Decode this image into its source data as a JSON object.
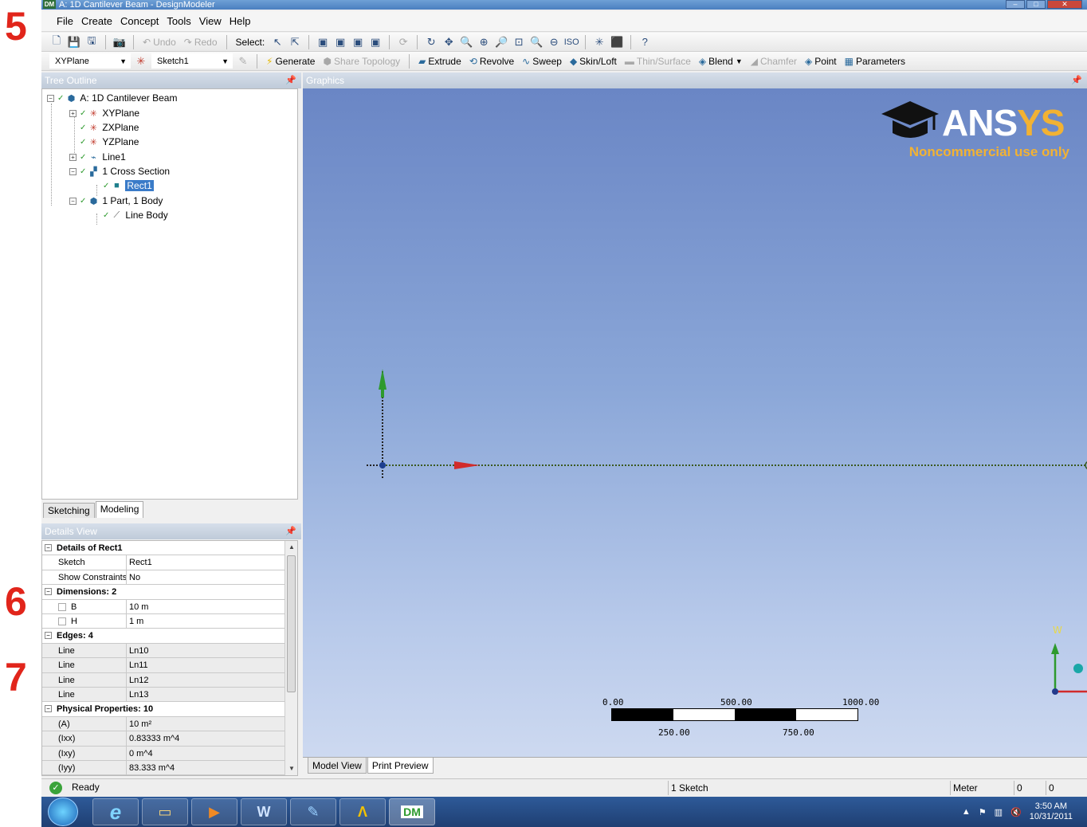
{
  "annotations": [
    "5",
    "6",
    "7"
  ],
  "window": {
    "title": "A: 1D Cantilever Beam - DesignModeler",
    "app_icon": "DM"
  },
  "menu": [
    "File",
    "Create",
    "Concept",
    "Tools",
    "View",
    "Help"
  ],
  "toolbar1": {
    "undo_label": "Undo",
    "redo_label": "Redo",
    "select_label": "Select:"
  },
  "toolbar2": {
    "plane_select": "XYPlane",
    "sketch_select": "Sketch1",
    "generate": "Generate",
    "share_topology": "Share Topology",
    "extrude": "Extrude",
    "revolve": "Revolve",
    "sweep": "Sweep",
    "skin_loft": "Skin/Loft",
    "thin_surface": "Thin/Surface",
    "blend": "Blend",
    "chamfer": "Chamfer",
    "point": "Point",
    "parameters": "Parameters"
  },
  "tree": {
    "header": "Tree Outline",
    "root": "A: 1D Cantilever Beam",
    "items": [
      "XYPlane",
      "ZXPlane",
      "YZPlane",
      "Line1",
      "1 Cross Section",
      "Rect1",
      "1 Part, 1 Body",
      "Line Body"
    ]
  },
  "mode_tabs": [
    "Sketching",
    "Modeling"
  ],
  "details": {
    "header": "Details View",
    "title_group": "Details of Rect1",
    "rows_main": [
      {
        "label": "Sketch",
        "value": "Rect1"
      },
      {
        "label": "Show Constraints?",
        "value": "No"
      }
    ],
    "dimensions_group": "Dimensions: 2",
    "dimensions": [
      {
        "label": "B",
        "value": "10 m"
      },
      {
        "label": "H",
        "value": "1 m"
      }
    ],
    "edges_group": "Edges: 4",
    "edges": [
      {
        "label": "Line",
        "value": "Ln10"
      },
      {
        "label": "Line",
        "value": "Ln11"
      },
      {
        "label": "Line",
        "value": "Ln12"
      },
      {
        "label": "Line",
        "value": "Ln13"
      }
    ],
    "physical_group": "Physical Properties: 10",
    "physical": [
      {
        "label": "(A)",
        "value": "10 m²"
      },
      {
        "label": "(Ixx)",
        "value": "0.83333 m^4"
      },
      {
        "label": "(Ixy)",
        "value": "0 m^4"
      },
      {
        "label": "(Iyy)",
        "value": "83.333 m^4"
      }
    ]
  },
  "graphics": {
    "header": "Graphics",
    "logo_brand_a": "ANS",
    "logo_brand_b": "YS",
    "logo_note": "Noncommercial use only",
    "scale": {
      "top_labels": [
        "0.00",
        "500.00",
        "1000.00 (m)"
      ],
      "bottom_labels": [
        "250.00",
        "750.00"
      ]
    },
    "triad": {
      "w": "W",
      "v": "V"
    }
  },
  "view_tabs": [
    "Model View",
    "Print Preview"
  ],
  "status": {
    "state": "Ready",
    "sketch_count": "1 Sketch",
    "units": "Meter",
    "x": "0",
    "y": "0"
  },
  "taskbar": {
    "time": "3:50 AM",
    "date": "10/31/2011"
  },
  "colors": {
    "accent_red": "#e1251b",
    "viewport_top": "#6a86c5",
    "ansys_gold": "#f2b233",
    "axis_green": "#2e9a2e",
    "axis_red": "#d12b2b"
  }
}
